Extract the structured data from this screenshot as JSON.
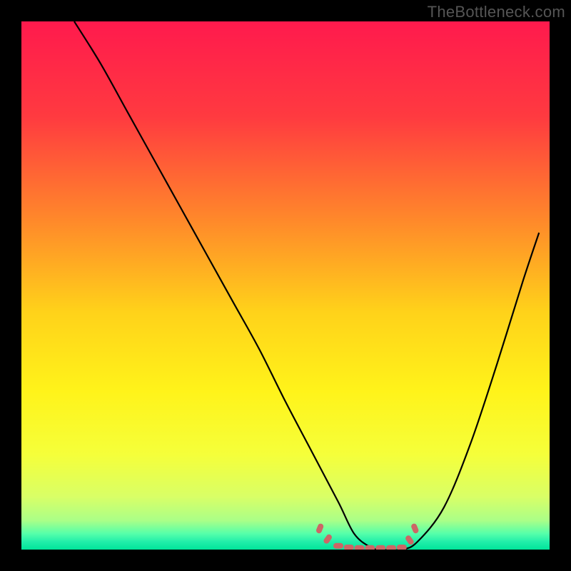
{
  "watermark": "TheBottleneck.com",
  "colors": {
    "frame": "#000000",
    "watermark": "#555555",
    "curve": "#000000",
    "marker": "#cc6666"
  },
  "chart_data": {
    "type": "line",
    "title": "",
    "xlabel": "",
    "ylabel": "",
    "xlim": [
      0,
      100
    ],
    "ylim": [
      0,
      100
    ],
    "gradient_stops": [
      {
        "offset": 0.0,
        "color": "#ff1a4d"
      },
      {
        "offset": 0.18,
        "color": "#ff3a40"
      },
      {
        "offset": 0.38,
        "color": "#ff8a2a"
      },
      {
        "offset": 0.55,
        "color": "#ffd21a"
      },
      {
        "offset": 0.7,
        "color": "#fff31a"
      },
      {
        "offset": 0.82,
        "color": "#f5ff3a"
      },
      {
        "offset": 0.9,
        "color": "#d9ff66"
      },
      {
        "offset": 0.945,
        "color": "#aaff88"
      },
      {
        "offset": 0.97,
        "color": "#55ffaa"
      },
      {
        "offset": 0.985,
        "color": "#22eeaa"
      },
      {
        "offset": 1.0,
        "color": "#00e59a"
      }
    ],
    "series": [
      {
        "name": "bottleneck-curve",
        "x": [
          10,
          15,
          20,
          25,
          30,
          35,
          40,
          45,
          50,
          55,
          60,
          63,
          66,
          68,
          72,
          75,
          80,
          85,
          90,
          95,
          98
        ],
        "values": [
          100,
          92,
          83,
          74,
          65,
          56,
          47,
          38,
          28,
          18.5,
          9,
          3,
          0.5,
          0,
          0,
          1.5,
          8,
          20,
          35,
          51,
          60
        ]
      }
    ],
    "plateau_markers": {
      "name": "optimal-range",
      "x": [
        56.5,
        58,
        60,
        62,
        64,
        66,
        68,
        70,
        72,
        73.5,
        74.5
      ],
      "values": [
        4.0,
        2.0,
        0.7,
        0.4,
        0.3,
        0.3,
        0.3,
        0.3,
        0.4,
        1.8,
        4.0
      ]
    }
  }
}
